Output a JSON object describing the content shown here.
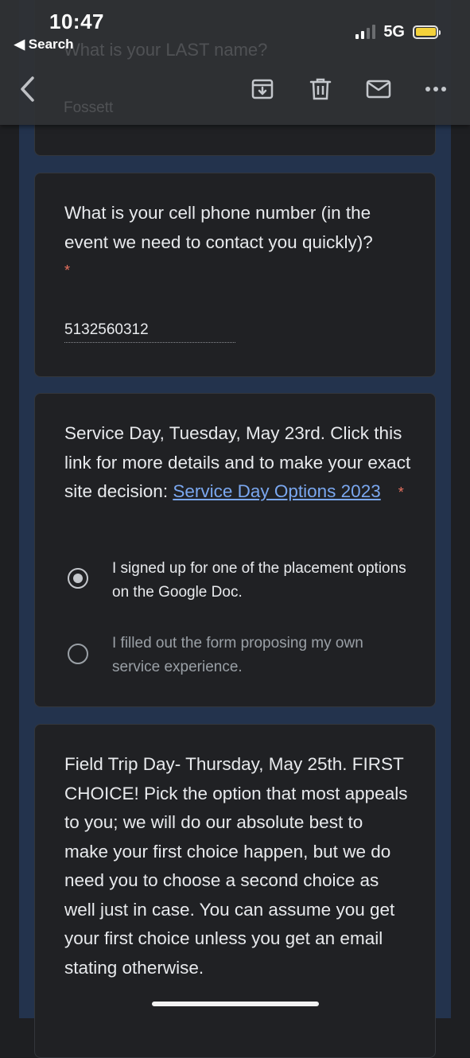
{
  "status_bar": {
    "time": "10:47",
    "back_app_label": "◀ Search",
    "network": "5G"
  },
  "behind_header": {
    "question": "What is your LAST name?",
    "answer": "Fossett"
  },
  "toolbar": {
    "icons": [
      "back-chevron-icon",
      "archive-icon",
      "trash-icon",
      "mail-icon",
      "more-icon"
    ]
  },
  "phone_question": {
    "text": "What is your cell phone number (in the event we need to contact you quickly)?",
    "required_mark": "*",
    "answer": "5132560312"
  },
  "service_day_question": {
    "text_before_link": "Service Day, Tuesday, May 23rd. Click this link for more details and to make your exact site decision: ",
    "link_text": "Service Day Options 2023",
    "required_mark": "*",
    "options": [
      {
        "label": "I signed up for one of the placement options on the Google Doc.",
        "selected": true
      },
      {
        "label": "I filled out the form proposing my own service experience.",
        "selected": false
      }
    ]
  },
  "field_trip_question": {
    "text": "Field Trip Day- Thursday, May 25th. FIRST CHOICE! Pick the option that most appeals to you; we will do our absolute best to make your first choice happen, but we do need you to choose a second choice as well just in case. You can assume you get your first choice unless you get an email stating otherwise."
  }
}
